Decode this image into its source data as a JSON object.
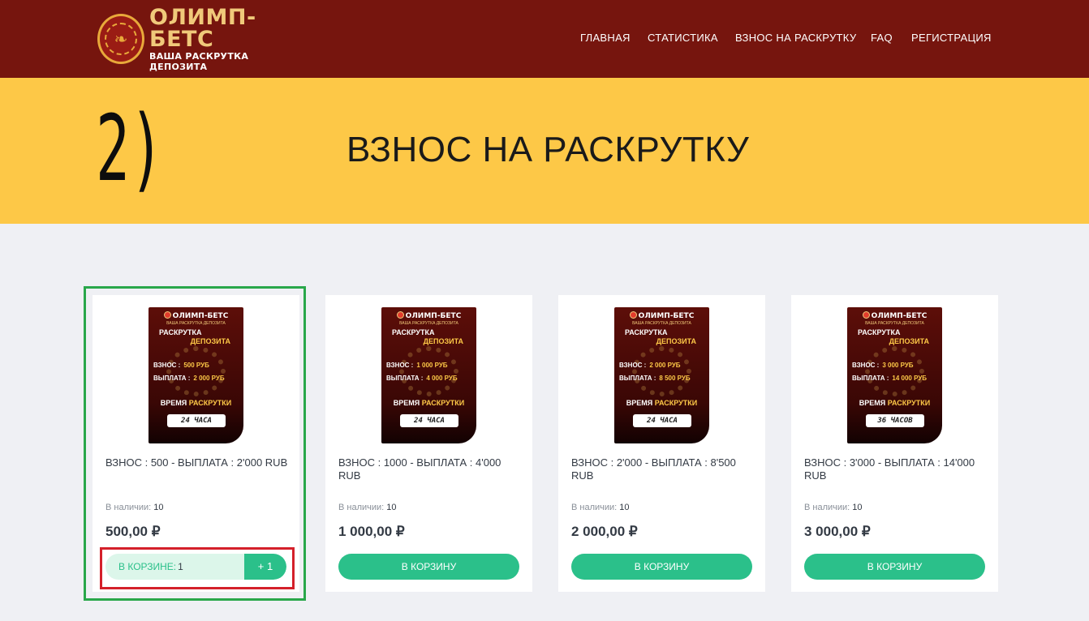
{
  "header": {
    "logo_name": "ОЛИМП-БЕТС",
    "logo_tagline": "ВАША РАСКРУТКА ДЕПОЗИТА",
    "nav": [
      "ГЛАВНАЯ",
      "СТАТИСТИКА",
      "ВЗНОС НА РАСКРУТКУ",
      "FAQ",
      "РЕГИСТРАЦИЯ"
    ]
  },
  "hero": {
    "step": "2)",
    "title": "ВЗНОС НА РАСКРУТКУ"
  },
  "products": [
    {
      "title": "ВЗНОС : 500 - ВЫПЛАТА : 2'000 RUB",
      "stock_label": "В наличии:",
      "stock": "10",
      "price": "500,00 ₽",
      "cart_label": "В КОРЗИНЕ:",
      "cart_count": "1",
      "plus_label": "+ 1",
      "image": {
        "brand": "ОЛИМП-БЕТС",
        "sub": "ВАША РАСКРУТКА ДЕПОЗИТА",
        "h1": "РАСКРУТКА",
        "h2": "ДЕПОЗИТА",
        "in_label": "ВЗНОС :",
        "in_val": "500 РУБ",
        "out_label": "ВЫПЛАТА :",
        "out_val": "2 000 РУБ",
        "time_a": "ВРЕМЯ",
        "time_b": "РАСКРУТКИ",
        "hours": "24 ЧАСА"
      }
    },
    {
      "title": "ВЗНОС : 1000 - ВЫПЛАТА : 4'000 RUB",
      "stock_label": "В наличии:",
      "stock": "10",
      "price": "1 000,00 ₽",
      "button": "В КОРЗИНУ",
      "image": {
        "brand": "ОЛИМП-БЕТС",
        "sub": "ВАША РАСКРУТКА ДЕПОЗИТА",
        "h1": "РАСКРУТКА",
        "h2": "ДЕПОЗИТА",
        "in_label": "ВЗНОС :",
        "in_val": "1 000 РУБ",
        "out_label": "ВЫПЛАТА :",
        "out_val": "4 000 РУБ",
        "time_a": "ВРЕМЯ",
        "time_b": "РАСКРУТКИ",
        "hours": "24 ЧАСА"
      }
    },
    {
      "title": "ВЗНОС : 2'000 - ВЫПЛАТА : 8'500 RUB",
      "stock_label": "В наличии:",
      "stock": "10",
      "price": "2 000,00 ₽",
      "button": "В КОРЗИНУ",
      "image": {
        "brand": "ОЛИМП-БЕТС",
        "sub": "ВАША РАСКРУТКА ДЕПОЗИТА",
        "h1": "РАСКРУТКА",
        "h2": "ДЕПОЗИТА",
        "in_label": "ВЗНОС :",
        "in_val": "2 000 РУБ",
        "out_label": "ВЫПЛАТА :",
        "out_val": "8 500 РУБ",
        "time_a": "ВРЕМЯ",
        "time_b": "РАСКРУТКИ",
        "hours": "24 ЧАСА"
      }
    },
    {
      "title": "ВЗНОС : 3'000 - ВЫПЛАТА : 14'000 RUB",
      "stock_label": "В наличии:",
      "stock": "10",
      "price": "3 000,00 ₽",
      "button": "В КОРЗИНУ",
      "image": {
        "brand": "ОЛИМП-БЕТС",
        "sub": "ВАША РАСКРУТКА ДЕПОЗИТА",
        "h1": "РАСКРУТКА",
        "h2": "ДЕПОЗИТА",
        "in_label": "ВЗНОС :",
        "in_val": "3 000 РУБ",
        "out_label": "ВЫПЛАТА :",
        "out_val": "14 000 РУБ",
        "time_a": "ВРЕМЯ",
        "time_b": "РАСКРУТКИ",
        "hours": "36 ЧАСОВ"
      }
    }
  ],
  "colors": {
    "header_bg": "#76150e",
    "hero_bg": "#fdc847",
    "accent_green": "#2bc08a",
    "highlight_green": "#29a74a",
    "highlight_red": "#d4202a"
  }
}
